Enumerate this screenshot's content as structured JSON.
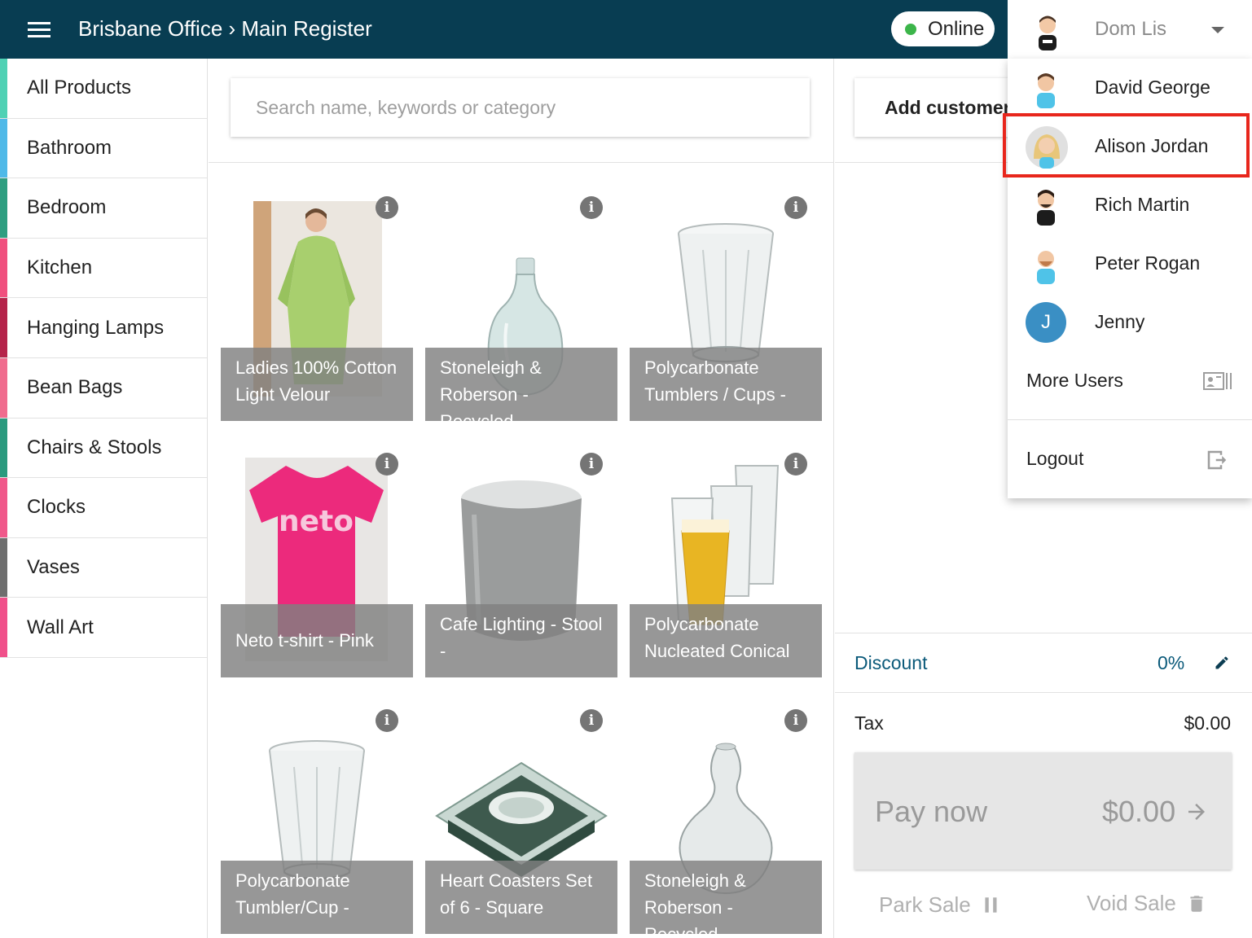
{
  "header": {
    "breadcrumb": "Brisbane Office › Main Register",
    "status": "Online",
    "current_user": "Dom Lis"
  },
  "colors": {
    "header_bg": "#083d52",
    "online_dot": "#3cb54a",
    "highlight_border": "#e8261c",
    "accent_text": "#0b5a7a"
  },
  "sidebar": {
    "categories": [
      {
        "label": "All Products",
        "color": "#4fd1b4"
      },
      {
        "label": "Bathroom",
        "color": "#4fb9e8"
      },
      {
        "label": "Bedroom",
        "color": "#2e9e80"
      },
      {
        "label": "Kitchen",
        "color": "#f0507e"
      },
      {
        "label": "Hanging Lamps",
        "color": "#b5234a"
      },
      {
        "label": "Bean Bags",
        "color": "#f06c8e"
      },
      {
        "label": "Chairs & Stools",
        "color": "#2a9a7e"
      },
      {
        "label": "Clocks",
        "color": "#f0588a"
      },
      {
        "label": "Vases",
        "color": "#6e6e6e"
      },
      {
        "label": "Wall Art",
        "color": "#f0508a"
      }
    ]
  },
  "search": {
    "placeholder": "Search name, keywords or category"
  },
  "products": [
    {
      "name": "Ladies 100% Cotton Light Velour",
      "image": "robe"
    },
    {
      "name": "Stoneleigh & Roberson - Recycled",
      "image": "demijohn"
    },
    {
      "name": "Polycarbonate Tumblers / Cups -",
      "image": "tumbler"
    },
    {
      "name": "Neto t-shirt - Pink",
      "image": "tshirt"
    },
    {
      "name": "Cafe Lighting - Stool -",
      "image": "stool"
    },
    {
      "name": "Polycarbonate Nucleated Conical",
      "image": "conical-glasses"
    },
    {
      "name": "Polycarbonate Tumbler/Cup -",
      "image": "tumbler"
    },
    {
      "name": "Heart Coasters Set of 6 - Square",
      "image": "coasters"
    },
    {
      "name": "Stoneleigh & Roberson - Recycled",
      "image": "gourd-vase"
    }
  ],
  "tshirt_logo": "neto",
  "cart": {
    "add_customer": "Add customer",
    "discount_label": "Discount",
    "discount_value": "0%",
    "tax_label": "Tax",
    "tax_value": "$0.00",
    "pay_label": "Pay now",
    "pay_amount": "$0.00",
    "park_sale": "Park Sale",
    "void_sale": "Void Sale"
  },
  "user_menu": {
    "users": [
      {
        "name": "David George",
        "avatar": "avatar-david"
      },
      {
        "name": "Alison Jordan",
        "avatar": "avatar-alison"
      },
      {
        "name": "Rich Martin",
        "avatar": "avatar-rich"
      },
      {
        "name": "Peter Rogan",
        "avatar": "avatar-peter"
      },
      {
        "name": "Jenny",
        "initial": "J"
      }
    ],
    "more_users": "More Users",
    "logout": "Logout"
  }
}
